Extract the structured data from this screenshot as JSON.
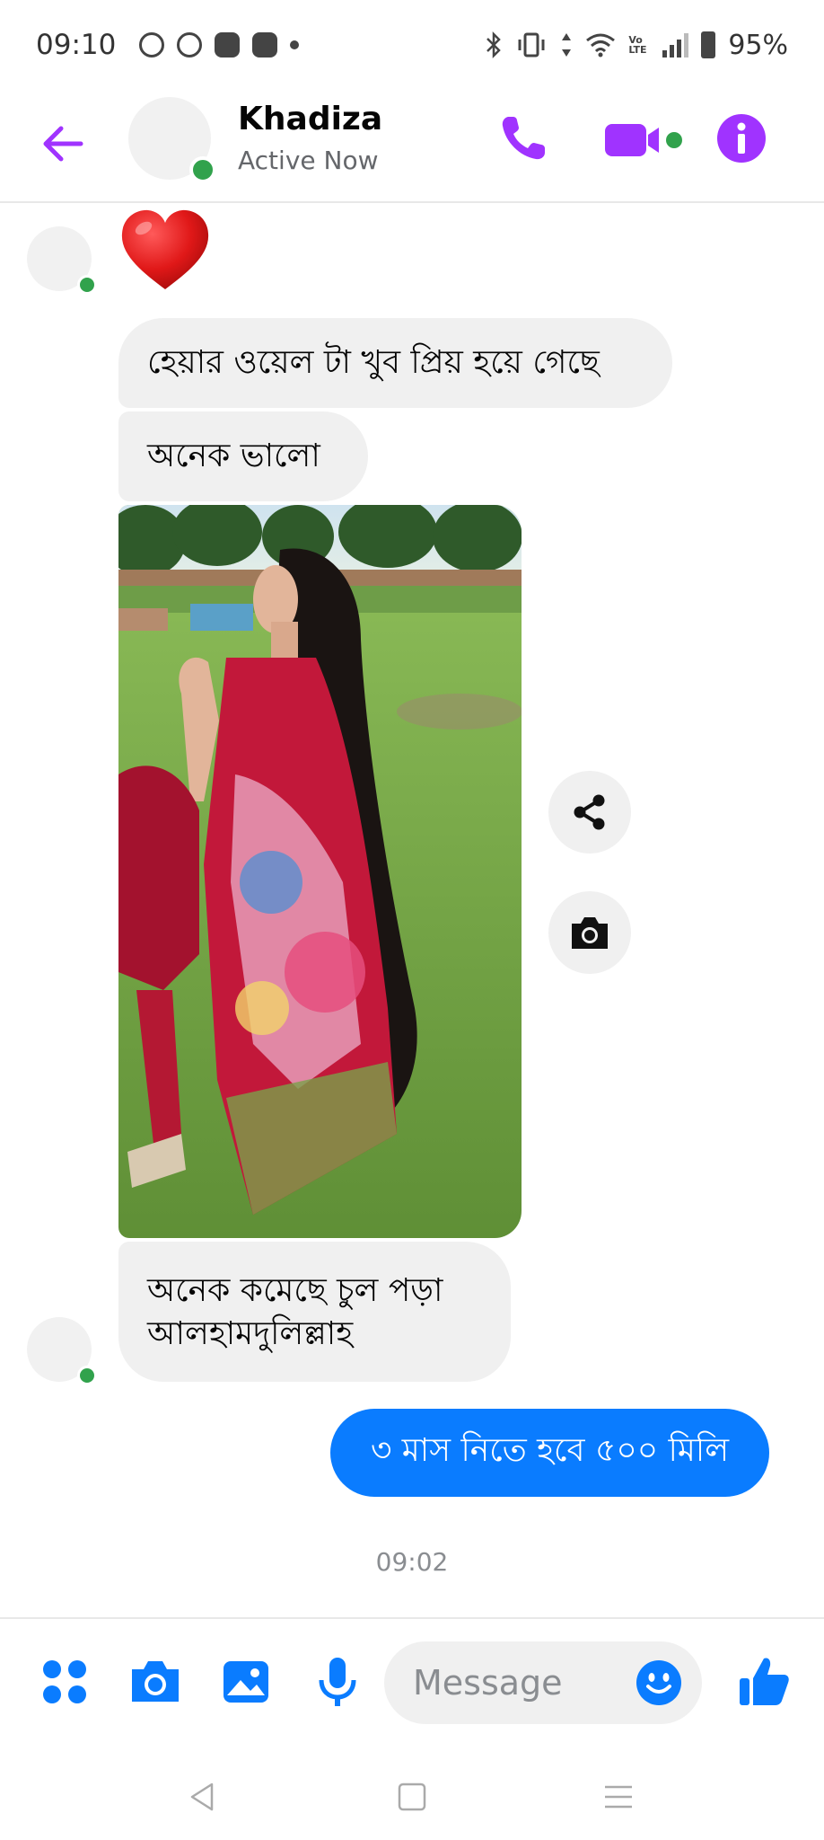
{
  "status_bar": {
    "time": "09:10",
    "left_icons": [
      "whatsapp-icon",
      "messenger-icon",
      "heart-app-icon",
      "heart-app-icon",
      "dot-icon"
    ],
    "right_icons": [
      "bluetooth-icon",
      "vibrate-icon",
      "data-arrows-icon",
      "wifi-icon",
      "volte-icon",
      "signal-icon",
      "battery-icon"
    ],
    "volte": "Vo LTE",
    "battery": "95%"
  },
  "header": {
    "back_icon": "arrow-left-icon",
    "name": "Khadiza",
    "status": "Active Now",
    "call_icon": "phone-icon",
    "video_icon": "video-camera-icon",
    "info_icon": "info-icon",
    "accent_color": "#a033ff"
  },
  "messages": {
    "reaction": "heart-emoji",
    "incoming": [
      {
        "text": "হেয়ার ওয়েল টা খুব প্রিয় হয়ে গেছে"
      },
      {
        "text": "অনেক ভালো"
      },
      {
        "type": "image",
        "description_icon": "photo-woman-long-hair"
      },
      {
        "line1": "অনেক কমেছে চুল পড়া",
        "line2": "আলহামদুলিল্লাহ"
      }
    ],
    "outgoing": [
      {
        "text": "৩ মাস নিতে হবে ৫০০ মিলি"
      }
    ],
    "timestamp": "09:02",
    "bubble_out_color": "#0a7cff"
  },
  "composer": {
    "apps_icon": "four-dots-icon",
    "camera_icon": "camera-icon",
    "gallery_icon": "image-icon",
    "mic_icon": "microphone-icon",
    "placeholder": "Message",
    "emoji_icon": "smiley-icon",
    "like_icon": "thumbs-up-icon",
    "icon_color": "#0a7cff"
  },
  "nav_bar": {
    "icons": [
      "back-triangle-icon",
      "home-square-icon",
      "menu-lines-icon"
    ]
  }
}
